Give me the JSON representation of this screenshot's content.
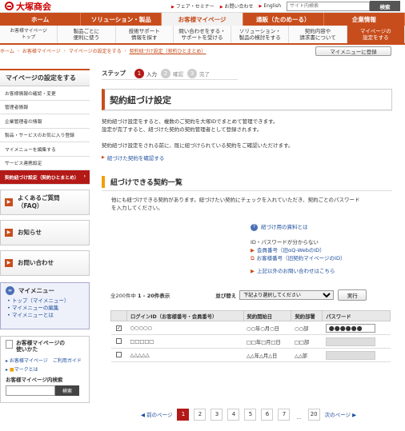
{
  "header": {
    "brand": "大塚商会",
    "links": [
      "フェア・セミナー",
      "お問い合わせ",
      "English"
    ],
    "search_placeholder": "サイト内検索",
    "search_button": "検索"
  },
  "gnav": [
    "ホーム",
    "ソリューション・製品",
    "お客様マイページ",
    "通販（たのめーる）",
    "企業情報"
  ],
  "gnav_active": 2,
  "subnav": [
    {
      "l1": "お客様マイページ",
      "l2": "トップ"
    },
    {
      "l1": "製品ごとに",
      "l2": "便利に使う"
    },
    {
      "l1": "技術サポート",
      "l2": "情報を探す"
    },
    {
      "l1": "問い合わせをする・",
      "l2": "サポートを受ける"
    },
    {
      "l1": "ソリューション・",
      "l2": "製品の検討をする"
    },
    {
      "l1": "契約内容や",
      "l2": "請求書について"
    },
    {
      "l1": "マイページの",
      "l2": "設定をする"
    }
  ],
  "breadcrumb": [
    "ホーム",
    "お客様マイページ",
    "マイページの設定をする",
    "契約紐づけ設定（契約ひとまとめ）"
  ],
  "mymenu_button": "マイメニューに登録",
  "sidebar": {
    "title": "マイページの設定をする",
    "items": [
      "お客様情報の確認・変更",
      "管理者情報",
      "企業管理者の情報",
      "製品・サービスのお気に入り登録",
      "マイメニューを編集する",
      "サービス連携設定",
      "契約紐づけ設定（契約ひとまとめ）"
    ],
    "active_arrow": "›",
    "buttons": [
      {
        "l1": "よくあるご質問",
        "l2": "（FAQ）"
      },
      {
        "l1": "お知らせ",
        "l2": ""
      },
      {
        "l1": "お問い合わせ",
        "l2": ""
      }
    ],
    "mymenu": {
      "title": "マイメニュー",
      "links": [
        "トップ（マイメニュー）",
        "マイメニューの編集",
        "マイメニューとは"
      ]
    },
    "guide": {
      "title1": "お客様マイページの",
      "title2": "使いかた",
      "link1": "お客様マイページ",
      "link2": "ご利用ガイド",
      "mark": "マークとは",
      "search_label": "お客様マイページ内検索",
      "search_button": "検索"
    }
  },
  "steps": {
    "label": "ステップ",
    "items": [
      {
        "n": "1",
        "t": "入力"
      },
      {
        "n": "2",
        "t": "確認"
      },
      {
        "n": "3",
        "t": "完了"
      }
    ],
    "active": 0
  },
  "page_title": "契約紐づけ設定",
  "intro": [
    "契約紐づけ設定をすると、複数のご契約を大塚IDでまとめて管理できます。",
    "設定が完了すると、紐づけた契約の契約管理者として登録されます。",
    "",
    "契約紐づけ設定をされる前に、既に紐づけられている契約をご確認いただけます。"
  ],
  "confirm_link": "紐づけた契約を確認する",
  "section_title": "紐づけできる契約一覧",
  "section_text": [
    "他にも紐づけできる契約があります。紐づけたい契約にチェックを入れていただき、契約ごとのパスワード",
    "を入力してください。"
  ],
  "help": {
    "doc_link": "紐づけ用の資料とは",
    "lost_label": "ID・パスワードが分からない",
    "link_a": "会員番号（旧αQ-WebのID）",
    "link_b": "お客様番号（旧契約マイページのID）",
    "other": "上記以外のお問い合わせはこちら"
  },
  "list": {
    "count": "全200件中",
    "range": "1 - 20件表示",
    "sort_label": "並び替え",
    "sort_value": "下記より選択してください",
    "run": "実行"
  },
  "table": {
    "headers": [
      "",
      "ログインID（お客様番号・会員番号）",
      "契約開始日",
      "契約部署",
      "パスワード"
    ],
    "rows": [
      {
        "checked": "✓",
        "id": "○○○○○",
        "date": "○○年○月○日",
        "dept": "○○部",
        "pw": "●●●●●●",
        "disabled": false
      },
      {
        "checked": "",
        "id": "□□□□□",
        "date": "□□年□月□日",
        "dept": "□□部",
        "pw": "",
        "disabled": true
      },
      {
        "checked": "",
        "id": "△△△△△",
        "date": "△△年△月△日",
        "dept": "△△部",
        "pw": "",
        "disabled": true
      }
    ]
  },
  "pager": {
    "prev": "前のページ",
    "pages": [
      "1",
      "2",
      "3",
      "4",
      "5",
      "6",
      "7"
    ],
    "dots": "...",
    "last": "20",
    "next": "次のページ"
  },
  "colors": {
    "brand": "#c84d1c",
    "active": "#b31a17",
    "accent": "#f2a007",
    "link": "#1a4b9b"
  }
}
